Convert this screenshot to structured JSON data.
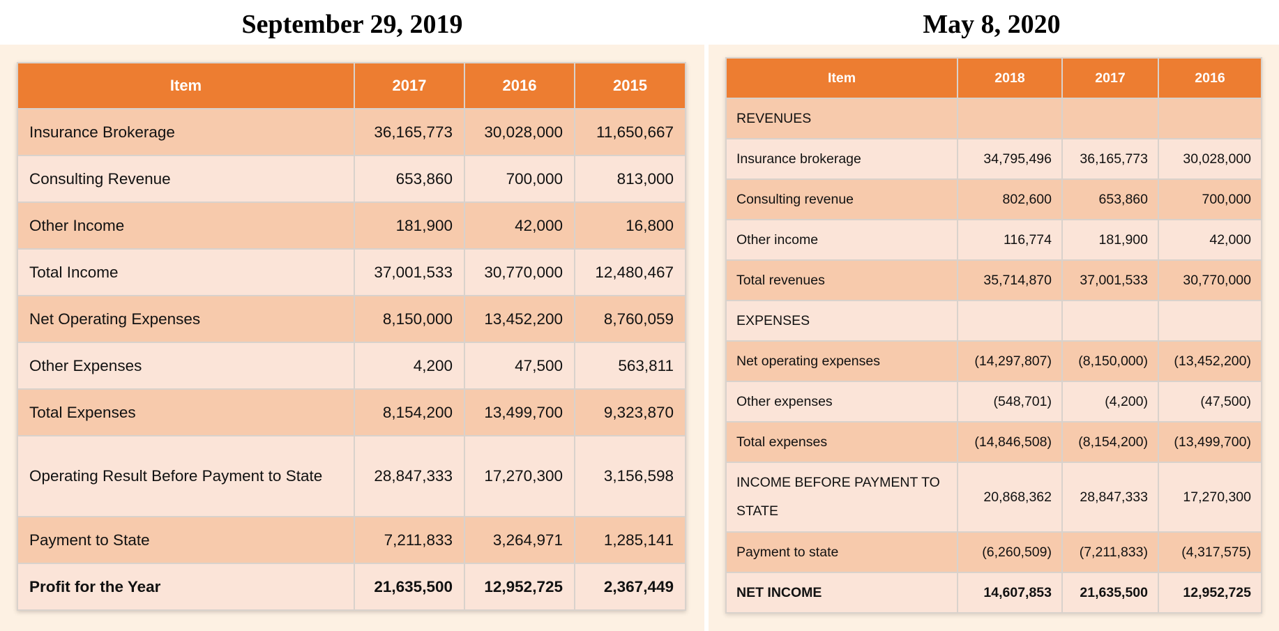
{
  "left": {
    "title": "September 29, 2019",
    "headers": [
      "Item",
      "2017",
      "2016",
      "2015"
    ],
    "rows": [
      {
        "item": "Insurance Brokerage",
        "v1": "36,165,773",
        "v2": "30,028,000",
        "v3": "11,650,667"
      },
      {
        "item": "Consulting Revenue",
        "v1": "653,860",
        "v2": "700,000",
        "v3": "813,000"
      },
      {
        "item": "Other Income",
        "v1": "181,900",
        "v2": "42,000",
        "v3": "16,800"
      },
      {
        "item": "Total Income",
        "v1": "37,001,533",
        "v2": "30,770,000",
        "v3": "12,480,467"
      },
      {
        "item": "Net Operating Expenses",
        "v1": "8,150,000",
        "v2": "13,452,200",
        "v3": "8,760,059"
      },
      {
        "item": "Other Expenses",
        "v1": "4,200",
        "v2": "47,500",
        "v3": "563,811"
      },
      {
        "item": "Total Expenses",
        "v1": "8,154,200",
        "v2": "13,499,700",
        "v3": "9,323,870"
      },
      {
        "item": "Operating Result Before Payment to State",
        "v1": "28,847,333",
        "v2": "17,270,300",
        "v3": "3,156,598"
      },
      {
        "item": "Payment to State",
        "v1": "7,211,833",
        "v2": "3,264,971",
        "v3": "1,285,141"
      },
      {
        "item": "Profit for the Year",
        "v1": "21,635,500",
        "v2": "12,952,725",
        "v3": "2,367,449"
      }
    ]
  },
  "right": {
    "title": "May 8, 2020",
    "headers": [
      "Item",
      "2018",
      "2017",
      "2016"
    ],
    "rows": [
      {
        "item": "REVENUES",
        "v1": "",
        "v2": "",
        "v3": ""
      },
      {
        "item": "Insurance brokerage",
        "v1": "34,795,496",
        "v2": "36,165,773",
        "v3": "30,028,000"
      },
      {
        "item": "Consulting revenue",
        "v1": "802,600",
        "v2": "653,860",
        "v3": "700,000"
      },
      {
        "item": "Other income",
        "v1": "116,774",
        "v2": "181,900",
        "v3": "42,000"
      },
      {
        "item": "Total revenues",
        "v1": "35,714,870",
        "v2": "37,001,533",
        "v3": "30,770,000"
      },
      {
        "item": "EXPENSES",
        "v1": "",
        "v2": "",
        "v3": ""
      },
      {
        "item": "Net operating expenses",
        "v1": "(14,297,807)",
        "v2": "(8,150,000)",
        "v3": "(13,452,200)"
      },
      {
        "item": "Other expenses",
        "v1": "(548,701)",
        "v2": "(4,200)",
        "v3": "(47,500)"
      },
      {
        "item": "Total expenses",
        "v1": "(14,846,508)",
        "v2": "(8,154,200)",
        "v3": "(13,499,700)"
      },
      {
        "item": "INCOME BEFORE PAYMENT TO STATE",
        "v1": "20,868,362",
        "v2": "28,847,333",
        "v3": "17,270,300"
      },
      {
        "item": "Payment to state",
        "v1": "(6,260,509)",
        "v2": "(7,211,833)",
        "v3": "(4,317,575)"
      },
      {
        "item": "NET INCOME",
        "v1": "14,607,853",
        "v2": "21,635,500",
        "v3": "12,952,725"
      }
    ]
  }
}
